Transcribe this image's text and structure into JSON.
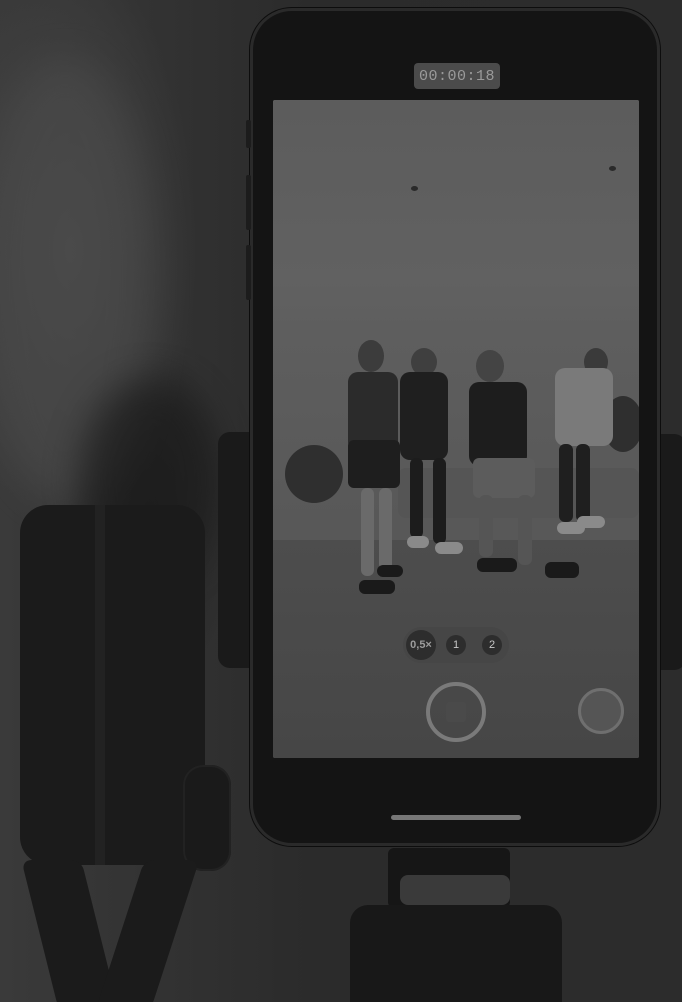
{
  "camera_app": {
    "timer": "00:00:18",
    "zoom_options": [
      "0,5×",
      "1",
      "2"
    ],
    "selected_zoom": "0,5×"
  },
  "colors": {
    "background": "#2a2a2a",
    "phone_body": "#141414",
    "screen_overlay": "#5a5a5a"
  },
  "icons": {
    "record": "stop-record-icon",
    "thumbnail": "gallery-thumbnail-icon"
  }
}
